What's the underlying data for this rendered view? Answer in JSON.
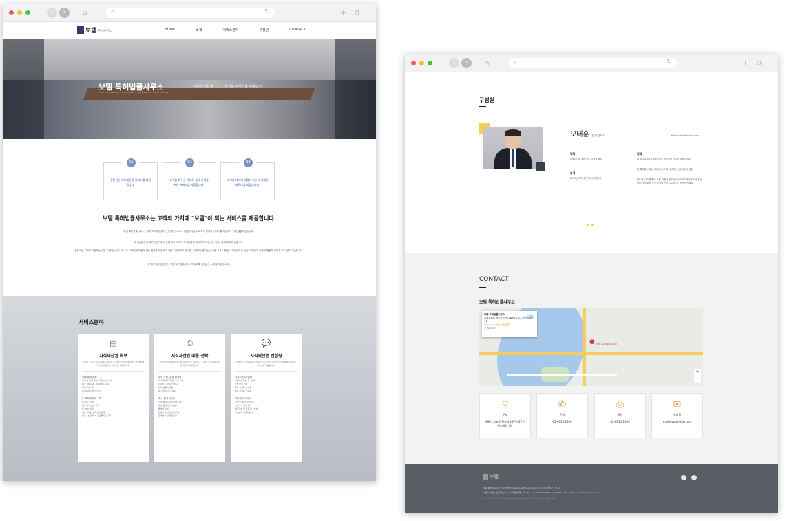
{
  "window1": {
    "nav": {
      "logo_text": "보탬",
      "logo_sub": "특허법률사무소",
      "menu": [
        "HOME",
        "소개",
        "서비스분야",
        "구성원",
        "CONTACT"
      ]
    },
    "hero": {
      "title": "보탬 특허법률사무소",
      "subtitle": "VOTEM INTELLECTUAL PROPERTY LAW FIRM",
      "slogan_pre": "고객의 가치에 ",
      "slogan_mark": "\"보탬\"",
      "slogan_post": "이 되는 서비스를 제공합니다."
    },
    "features": [
      {
        "num": "01",
        "text": "전문적인 지식재산권 서비스를 제공합니다."
      },
      {
        "num": "02",
        "text": "고객을 최우선 가치로 삼아 고객을 위한 서비스를 제공합니다."
      },
      {
        "num": "03",
        "text": "고객의 가치에 보탬이 되는 지식재산 파트너가 되겠습니다."
      }
    ],
    "intro": {
      "title": "보탬 특허법률사무소는 고객의 가치에 \"보탬\"이 되는 서비스를 제공합니다.",
      "paragraphs": [
        "보탬 특허법률사무소는 대형 특허법인에서 전문화된 서비스 경험을 바탕으로 고객 지향의 서비스를 제공하기 위해 설립되었습니다.",
        "각 기술분야의 특허 전문가들이 뜻을 모아 국내외 고객들에게 최적의 지식재산권 서비스를 제공하고 있습니다.",
        "전문가는 고객이 요청하는 것을 수행하는 것이 아니라 고객에게 보탬이 되는 전략을 제안하고 이를 지향하므로 업무를 수행해야 한다는 생각을 가지고 항상 고객입장에서 진단 IP 창출과 전략적 활용에 적극적으로 임하고 있습니다.",
        "고객과 함께 성장하는 보탬 특허법률사무소가 되도록 끊임없는 노력을 하겠습니다."
      ]
    },
    "services": {
      "title": "서비스분야",
      "cards": [
        {
          "icon": "document-icon",
          "title": "지식재산권 확보",
          "desc": "고객의 소중한 아이디어를 가치있는 지식재산권으로 확보하기 위한 체계적이고 전문적인 서비스를 제공합니다.",
          "groups": [
            {
              "head": "국내/해외 출원",
              "items": [
                "국내 및 해외 특허/디자인/상표 출원",
                "PCT, HAGUE, MADRID 출원",
                "해외 출원 번역",
                "번역특허 만을 전담업"
              ]
            },
            {
              "head": "IP 포트폴리오 구축",
              "items": [
                "IP 관리 컨설팅",
                "강한 특허 확보 전략",
                "IP R&D 전략",
                "활용 가능한 권리범위 설계",
                "비즈니스 연계 IP 포트폴리오 구축"
              ]
            }
          ]
        },
        {
          "icon": "strategy-icon",
          "title": "지식재산권 대응 전략",
          "desc": "지식재산권 분쟁 및 협상에 적극적으로 대응하고, 고객의 입장에서 유리한 전략을 제안합니다.",
          "groups": [
            {
              "head": "소송 수행, 분쟁 컨설팅",
              "items": [
                "국내 및 해외 심판, 소송 수행",
                "라이선스, 협상 컨설팅",
                "권리 활용 컨설팅",
                "IP 수익 창출 컨설팅"
              ]
            },
            {
              "head": "조사·분석 서비스",
              "items": [
                "선행 특허/디자인/상표 조사",
                "무효/침해 조사 및 분석",
                "특허맵 작성",
                "경쟁사 분석 및 모니터링",
                "권리분석 및 무효감정"
              ]
            }
          ]
        },
        {
          "icon": "consult-icon",
          "title": "지식재산권 컨설팅",
          "desc": "기술이전, 사업화 등 지식재산권과 관련된 다양한 사업분야에 전문적인 서비스를 제공합니다.",
          "groups": [
            {
              "head": "기술 이전/사업화",
              "items": [
                "기술이전 대상 조사/분석",
                "기술 이전 협상",
                "특허 사업화 컨설팅",
                "특허 사업화 컨설팅"
              ]
            },
            {
              "head": "가치평가 서비스",
              "items": [
                "기술 및 특허 가치평가",
                "기술가치 산정 평가",
                "경영기술 및 무형자산 분석",
                "기술분야 사업화분석"
              ]
            }
          ]
        }
      ]
    }
  },
  "window2": {
    "members": {
      "title": "구성원",
      "name": "오태훈",
      "role": "탐장 변리사",
      "email": "thoh@votemlaw.com",
      "edu_head": "학력",
      "edu": [
        "서울대학교 물리학과, 수학과 졸업"
      ],
      "cert_head": "자격",
      "cert": [
        "2001년 제52회 변리사시험합격"
      ],
      "career_head": "경력",
      "career": [
        "前 하나국제특허법률사무소 삼성전자 반도체 메모리 업무",
        "前 특허법인 정산 LG전자, LG디스플레이, 현대자동차 업무",
        "반도체, 디스플레이, 로봇, 자율주행 모빌리티소프트웨어/BM 국내 및 해외 심판/소송, IP분쟁 대응 전략, 특허분석, 브랜드 컨설팅"
      ]
    },
    "contact": {
      "title": "CONTACT",
      "company": "보탬 특허법률사무소",
      "map": {
        "info_title": "보탬 특허법률사무소",
        "info_addr": "서울특별시 서초구 강남대로97길 27 이앤씨빌딩 4층",
        "info_rating": "5.0 ★★★★★ 리뷰 2개",
        "info_link": "큰 지도 보기",
        "dir_label": "길찾기",
        "pin_label": "보탬 특허법률사무소"
      },
      "items": [
        {
          "icon": "location-icon",
          "label": "주소",
          "value": "서울시 서초구 강남대로97길 27 이앤씨빌딩 4층"
        },
        {
          "icon": "phone-icon",
          "label": "전화",
          "value": "02-6953-1909"
        },
        {
          "icon": "fax-icon",
          "label": "팩스",
          "value": "02-6954-1909"
        },
        {
          "icon": "mail-icon",
          "label": "이메일",
          "value": "mail@votemlaw.com"
        }
      ]
    },
    "footer": {
      "logo_text": "보탬",
      "line1": "보탬 특허법률사무소  |  VOTEM Intellectual Property Law Firm  대표 변리사 : 오태훈",
      "line2": "서울시 서초구 강남대로97길 27 이앤씨빌딩 4층  TEL : 02-6953-1909  FAX : 02-6954-1909  E-MAIL : mail@votemlaw.com",
      "line3": "COPYRIGHT VOTEM Intellectual Property Law Firm. All rights reserved."
    }
  }
}
